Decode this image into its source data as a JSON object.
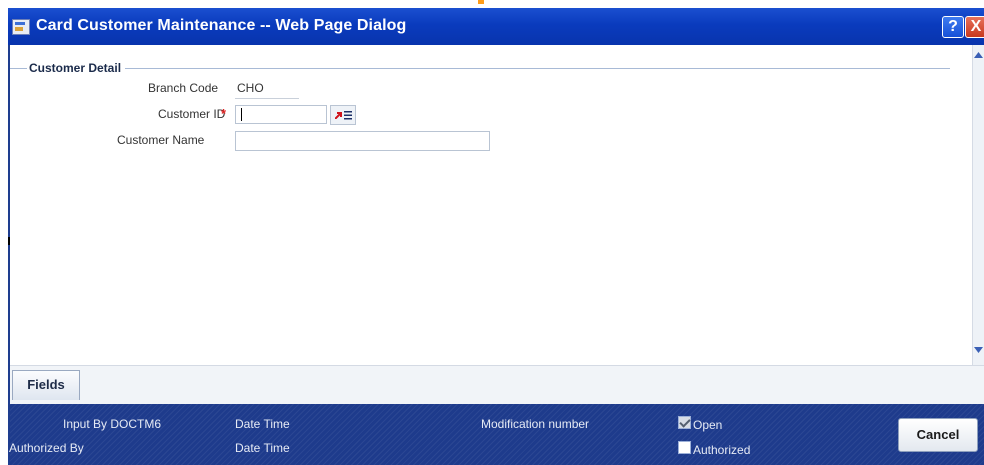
{
  "window": {
    "title": "Card Customer Maintenance -- Web Page Dialog",
    "help_label": "?",
    "close_label": "X"
  },
  "section": {
    "title": "Customer Detail"
  },
  "form": {
    "branch_code_label": "Branch Code",
    "branch_code_value": "CHO",
    "customer_id_label": "Customer ID",
    "customer_id_required": "*",
    "customer_id_value": "",
    "customer_name_label": "Customer Name",
    "customer_name_value": ""
  },
  "tabs": {
    "fields_label": "Fields"
  },
  "footer": {
    "input_by_label": "Input By DOCTM6",
    "date_time_1": "Date Time",
    "authorized_by_label": "Authorized By",
    "date_time_2": "Date Time",
    "modification_number_label": "Modification number",
    "open_label": "Open",
    "open_checked": true,
    "authorized_label": "Authorized",
    "authorized_checked": false,
    "cancel_label": "Cancel"
  },
  "colors": {
    "titlebar": "#0a3bbd",
    "footer": "#1e3b8c",
    "required": "#e02020"
  }
}
